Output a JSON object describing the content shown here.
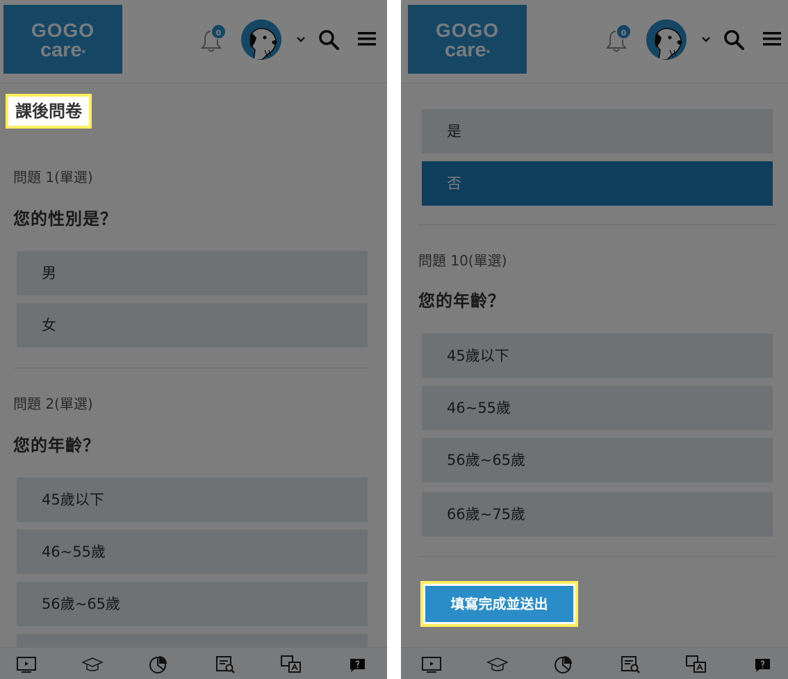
{
  "logo": {
    "line1": "GOGO",
    "line2": "care",
    "mark": "*"
  },
  "header": {
    "notification_count": "0"
  },
  "left": {
    "page_title": "課後問卷",
    "q1": {
      "meta": "問題 1(單選)",
      "title": "您的性別是？",
      "options": [
        "男",
        "女"
      ]
    },
    "q2": {
      "meta": "問題 2(單選)",
      "title": "您的年齡？",
      "options": [
        "45歲以下",
        "46~55歲",
        "56歲~65歲"
      ]
    }
  },
  "right": {
    "q9_options": [
      "是",
      "否"
    ],
    "q9_selected": "否",
    "q10": {
      "meta": "問題 10(單選)",
      "title": "您的年齡？",
      "options": [
        "45歲以下",
        "46~55歲",
        "56歲~65歲",
        "66歲~75歲"
      ]
    },
    "submit_label": "填寫完成並送出"
  },
  "bottom_nav": [
    "tv-icon",
    "graduation-cap-icon",
    "pie-chart-icon",
    "document-search-icon",
    "translate-chat-icon",
    "help-chat-icon"
  ],
  "colors": {
    "brand": "#2a8dc8",
    "selected": "#1f7bb8",
    "option_bg": "#dfe5eb",
    "highlight": "#ffef5e"
  }
}
